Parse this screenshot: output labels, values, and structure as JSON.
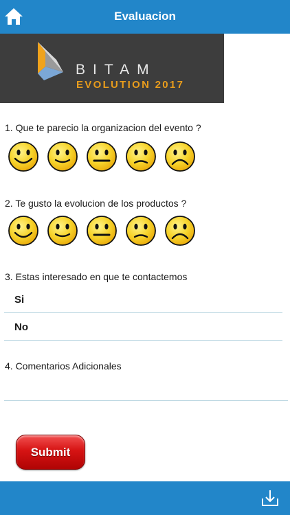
{
  "header": {
    "title": "Evaluacion",
    "home_icon": "home-icon"
  },
  "banner": {
    "brand": "BITAM",
    "edition": "EVOLUTION 2017"
  },
  "questions": {
    "q1": "1. Que te parecio la organizacion del evento ?",
    "q2": "2. Te gusto la evolucion de los productos ?",
    "q3": "3. Estas interesado en que te contactemos",
    "q4": "4. Comentarios Adicionales"
  },
  "rating_faces": [
    "very-happy-face-icon",
    "happy-face-icon",
    "neutral-face-icon",
    "sad-face-icon",
    "very-sad-face-icon"
  ],
  "contact_options": [
    "Si",
    "No"
  ],
  "comment": {
    "value": "",
    "placeholder": ""
  },
  "submit_label": "Submit",
  "footer": {
    "download_icon": "download-icon"
  },
  "colors": {
    "bar": "#2286c9",
    "face": "#f7d42c",
    "banner": "#3d3d3d",
    "accent": "#e89c1c",
    "submit": "#d61313"
  }
}
